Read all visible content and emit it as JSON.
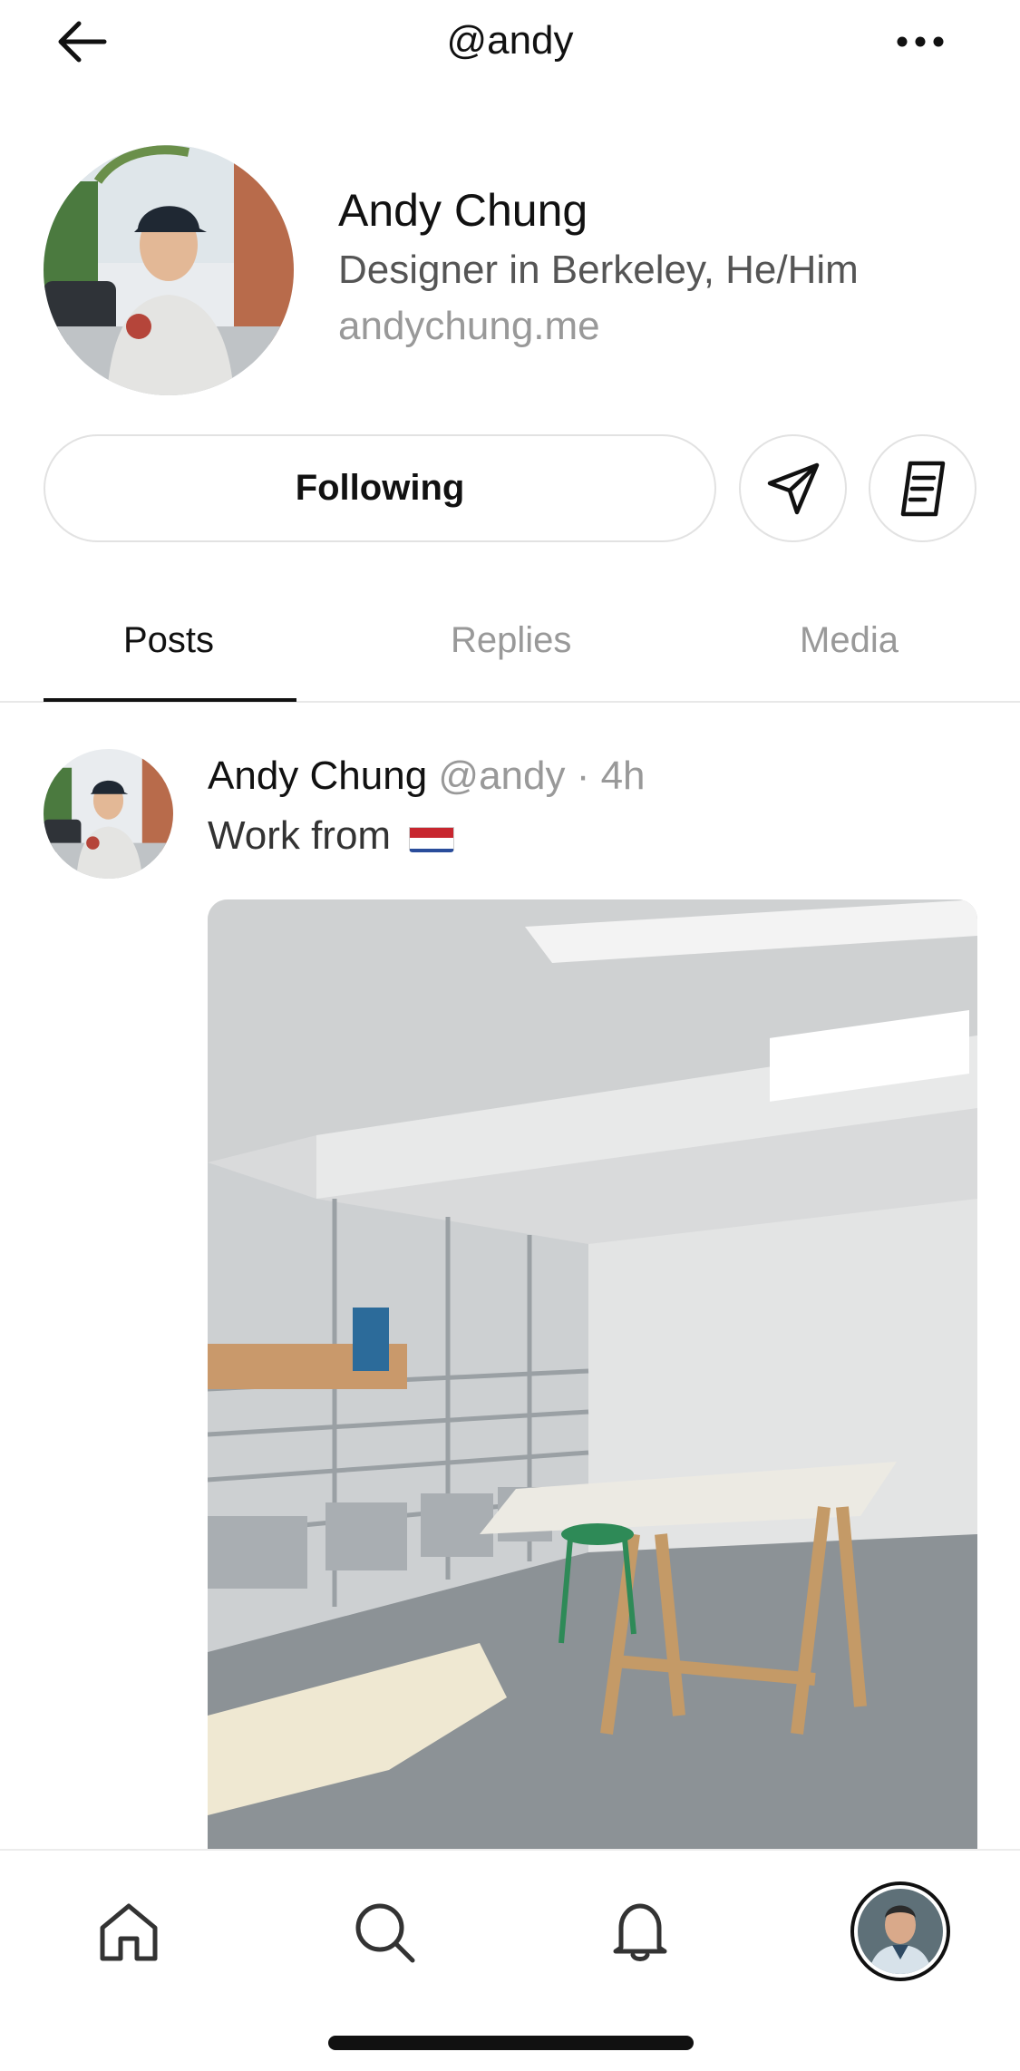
{
  "topbar": {
    "title": "@andy",
    "back_icon": "arrow-left-icon",
    "more_icon": "ellipsis-icon"
  },
  "profile": {
    "name": "Andy Chung",
    "bio": "Designer in Berkeley, He/Him",
    "link": "andychung.me",
    "follow_label": "Following",
    "mention_icon": "send-icon",
    "notes_icon": "document-icon"
  },
  "tabs": [
    {
      "label": "Posts",
      "active": true
    },
    {
      "label": "Replies",
      "active": false
    },
    {
      "label": "Media",
      "active": false
    }
  ],
  "post": {
    "author": "Andy Chung",
    "meta": "@andy · 4h",
    "text": "Work from",
    "flag": "Netherlands flag",
    "image_description": "Studio workspace with shelves and wooden table"
  },
  "nav": {
    "items": [
      "home-icon",
      "search-icon",
      "bell-icon",
      "profile-avatar"
    ]
  },
  "colors": {
    "text_primary": "#111111",
    "text_secondary": "#999999",
    "border": "#e2e2e2"
  }
}
